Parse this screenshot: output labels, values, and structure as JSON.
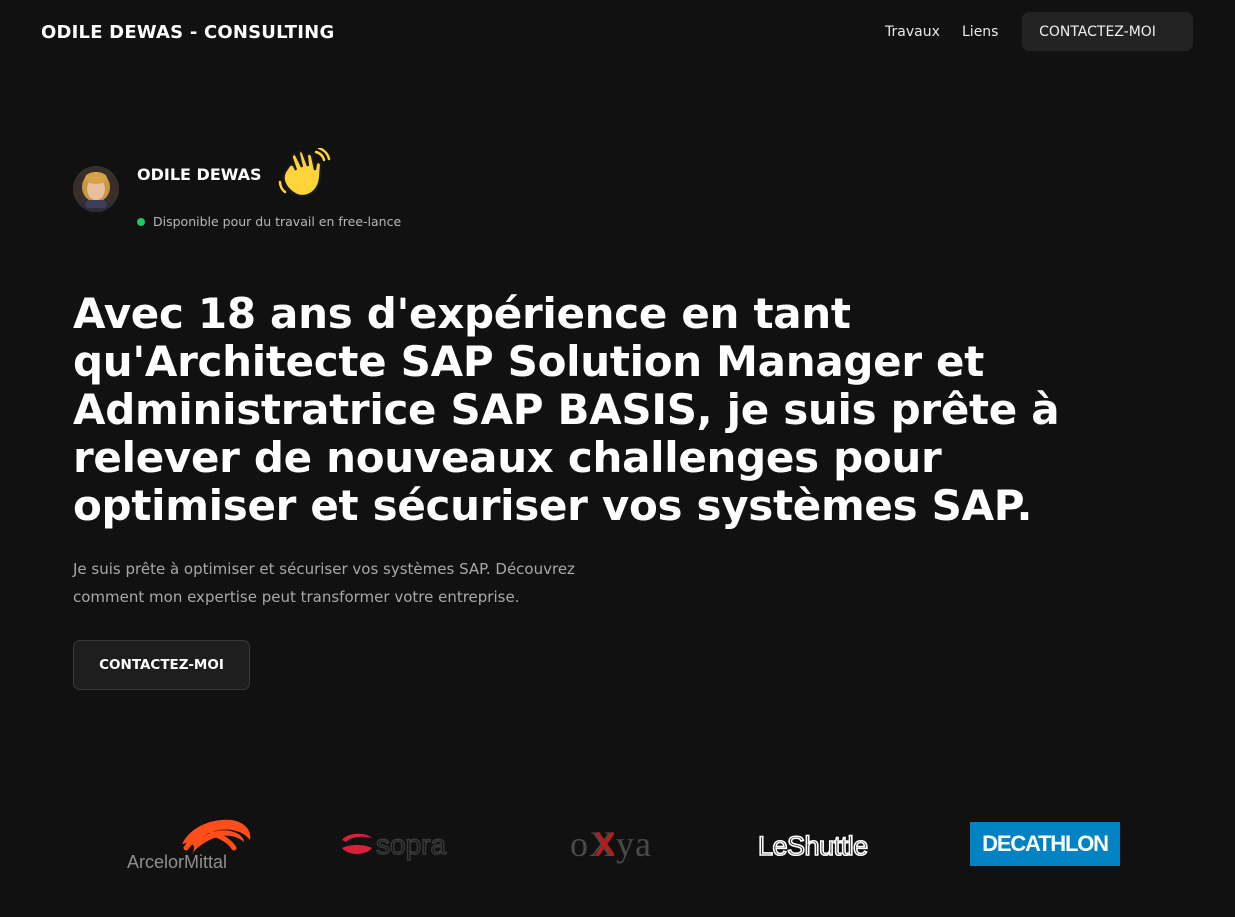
{
  "header": {
    "brand": "ODILE DEWAS - CONSULTING",
    "nav": {
      "travaux": "Travaux",
      "liens": "Liens",
      "contact": "CONTACTEZ-MOI"
    }
  },
  "profile": {
    "name": "ODILE DEWAS",
    "status": "Disponible pour du travail en free-lance",
    "status_color": "#22c55e",
    "icons": [
      "avatar",
      "waving-hand-icon"
    ]
  },
  "hero": {
    "title": "Avec 18 ans d'expérience en tant qu'Architecte SAP Solution Manager et Administratrice SAP BASIS, je suis prête à relever de nouveaux challenges pour optimiser et sécuriser vos systèmes SAP.",
    "subtitle": "Je suis prête à optimiser et sécuriser vos systèmes SAP. Découvrez comment mon expertise peut transformer votre entreprise.",
    "cta": "CONTACTEZ-MOI"
  },
  "logos": {
    "arcelormittal": "ArcelorMittal",
    "sopra": "sopra",
    "oxya": "oXya",
    "leshuttle": "LeShuttle",
    "decathlon": "DECATHLON"
  },
  "colors": {
    "background": "#111111",
    "arcelor_orange": "#ff4e1a",
    "sopra_red": "#d8213a",
    "oxya_red": "#b01e1e",
    "decathlon_blue": "#0082c3"
  }
}
